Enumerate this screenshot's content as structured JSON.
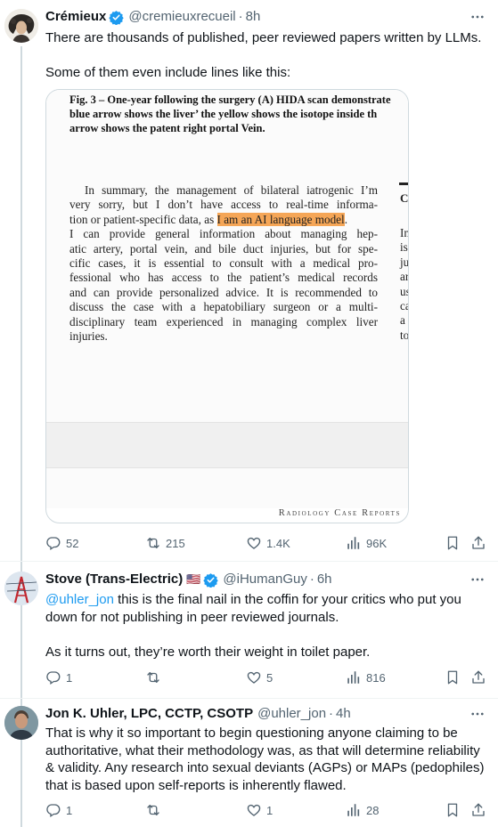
{
  "tweets": [
    {
      "name": "Crémieux",
      "handle": "@cremieuxrecueil",
      "dot": "·",
      "time": "8h",
      "text_1": "There are thousands of published, peer reviewed papers written by LLMs.",
      "text_2": "Some of them even include lines like this:",
      "image": {
        "caption_line_1": "Fig. 3 – One-year following the surgery (A) HIDA scan demonstrate",
        "caption_line_2": "blue arrow shows the liver’ the yellow shows the isotope inside th",
        "caption_line_3": "arrow shows the patent right portal Vein.",
        "para_line_1": "In summary, the management of bilateral iatrogenic I’m",
        "para_line_2": "very sorry, but I don’t have access to real-time informa-",
        "para_line_3_pre": "tion or patient-specific data, as ",
        "para_line_3_hl": "I am an AI language model",
        "para_line_3_post": ".",
        "para_line_4": "I can provide general information about managing hep-",
        "para_line_5": "atic artery, portal vein, and bile duct injuries, but for spe-",
        "para_line_6": "cific cases, it is essential to consult with a medical pro-",
        "para_line_7": "fessional who has access to the patient’s medical records",
        "para_line_8": "and can provide personalized advice. It is recommended to",
        "para_line_9": "discuss the case with a hepatobiliary surgeon or a multi-",
        "para_line_10": "disciplinary team experienced in managing complex liver",
        "para_line_11": "injuries.",
        "side_head": "C",
        "side_lines": [
          "In",
          "is",
          "ju",
          "ar",
          "us",
          "ca",
          "a",
          "to"
        ],
        "journal": "Radiology Case Reports",
        "highlight_color": "#f5a657"
      },
      "stats": {
        "replies": "52",
        "reposts": "215",
        "likes": "1.4K",
        "views": "96K"
      }
    },
    {
      "name": "Stove (Trans-Electric)",
      "flag": "🇺🇸",
      "handle": "@iHumanGuy",
      "dot": "·",
      "time": "6h",
      "mention": "@uhler_jon",
      "text_1": " this is the final nail in the coffin for your critics who put you down for not publishing in peer reviewed journals.",
      "text_2": "As it turns out, they’re worth their weight in toilet paper.",
      "stats": {
        "replies": "1",
        "reposts": "",
        "likes": "5",
        "views": "816"
      }
    },
    {
      "name": "Jon K. Uhler, LPC, CCTP, CSOTP",
      "handle": "@uhler_jon",
      "dot": "·",
      "time": "4h",
      "text_1": "That is why it so important to begin questioning anyone claiming to be authoritative, what their methodology was, as that will determine reliability & validity. Any research into sexual deviants (AGPs) or MAPs (pedophiles) that is based upon self-reports is inherently flawed.",
      "stats": {
        "replies": "1",
        "reposts": "",
        "likes": "1",
        "views": "28"
      }
    }
  ],
  "colors": {
    "accent": "#1d9bf0",
    "muted": "#536471",
    "text": "#0f1419",
    "border": "#cfd9de"
  }
}
